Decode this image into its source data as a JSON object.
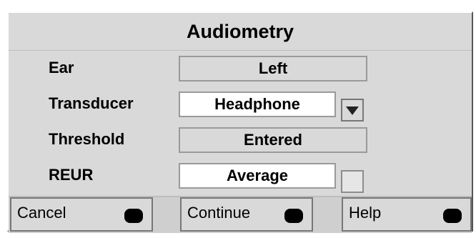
{
  "window": {
    "title": "Audiometry"
  },
  "rows": [
    {
      "label": "Ear",
      "value": "Left",
      "editable": false
    },
    {
      "label": "Transducer",
      "value": "Headphone",
      "editable": true
    },
    {
      "label": "Threshold",
      "value": "Entered",
      "editable": false
    },
    {
      "label": "REUR",
      "value": "Average",
      "editable": true
    }
  ],
  "buttons": {
    "cancel": "Cancel",
    "continue": "Continue",
    "help": "Help"
  },
  "icons": {
    "dropdown": "chevron-down-icon",
    "toggle": "checkbox-icon",
    "button_marker": "rounded-rectangle-icon"
  }
}
